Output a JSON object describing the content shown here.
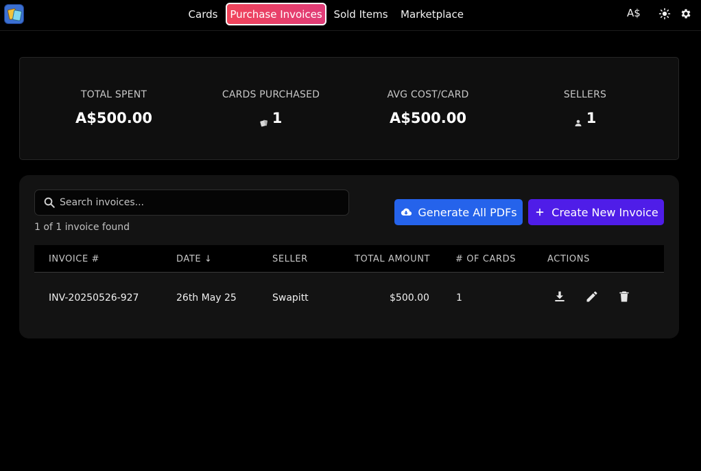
{
  "nav": {
    "items": [
      {
        "label": "Cards",
        "active": false
      },
      {
        "label": "Purchase Invoices",
        "active": true
      },
      {
        "label": "Sold Items",
        "active": false
      },
      {
        "label": "Marketplace",
        "active": false
      }
    ],
    "currency": "A$",
    "icons": [
      "app-logo-icon",
      "sun-icon",
      "gear-icon"
    ]
  },
  "stats": [
    {
      "label": "TOTAL SPENT",
      "value": "A$500.00",
      "icon": null
    },
    {
      "label": "CARDS PURCHASED",
      "value": "1",
      "icon": "cards-icon"
    },
    {
      "label": "AVG COST/CARD",
      "value": "A$500.00",
      "icon": null
    },
    {
      "label": "SELLERS",
      "value": "1",
      "icon": "person-icon"
    }
  ],
  "search": {
    "placeholder": "Search invoices...",
    "value": "",
    "result_text": "1 of 1 invoice found"
  },
  "buttons": {
    "generate_all": "Generate All PDFs",
    "create_new": "Create New Invoice"
  },
  "table": {
    "columns": [
      "INVOICE #",
      "DATE ↓",
      "SELLER",
      "TOTAL AMOUNT",
      "# OF CARDS",
      "ACTIONS"
    ],
    "rows": [
      {
        "invoice": "INV-20250526-927",
        "date": "26th May 25",
        "seller": "Swapitt",
        "total": "$500.00",
        "cards": "1",
        "actions": [
          "download-icon",
          "edit-icon",
          "delete-icon"
        ]
      }
    ]
  },
  "colors": {
    "active_tab_start": "#f0445a",
    "active_tab_end": "#e03c78",
    "generate_button": "#2563eb",
    "create_button": "#4f1de8",
    "background": "#000000"
  }
}
